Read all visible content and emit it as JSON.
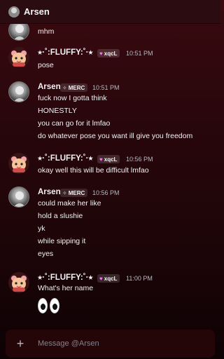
{
  "header": {
    "title": "Arsen"
  },
  "users": {
    "arsen": {
      "name": "Arsen",
      "tag": "MERC"
    },
    "fluffy": {
      "name": "⭑·˚:FLUFFY:˚·⭑",
      "tag": "xqcL"
    }
  },
  "messages": [
    {
      "lines": [
        "mhm"
      ]
    },
    {
      "time": "10:51 PM",
      "lines": [
        "pose"
      ]
    },
    {
      "time": "10:51 PM",
      "lines": [
        "fuck now I gotta think",
        "HONESTLY",
        "you can go for it lmfao",
        "do whatever pose you want ill give you freedom"
      ]
    },
    {
      "time": "10:56 PM",
      "lines": [
        "okay well this will be difficult lmfao"
      ]
    },
    {
      "time": "10:56 PM",
      "lines": [
        "could make her like",
        "hold a slushie",
        "yk",
        "while sipping it",
        "eyes"
      ]
    },
    {
      "time": "11:00 PM",
      "lines": [
        "What's her name"
      ],
      "emoji": "eyes-emoji"
    }
  ],
  "composer": {
    "placeholder": "Message @Arsen"
  },
  "colors": {
    "background_top": "#3a0a10",
    "background_bottom": "#0d0204",
    "tag_heart": "#ff73fa"
  }
}
